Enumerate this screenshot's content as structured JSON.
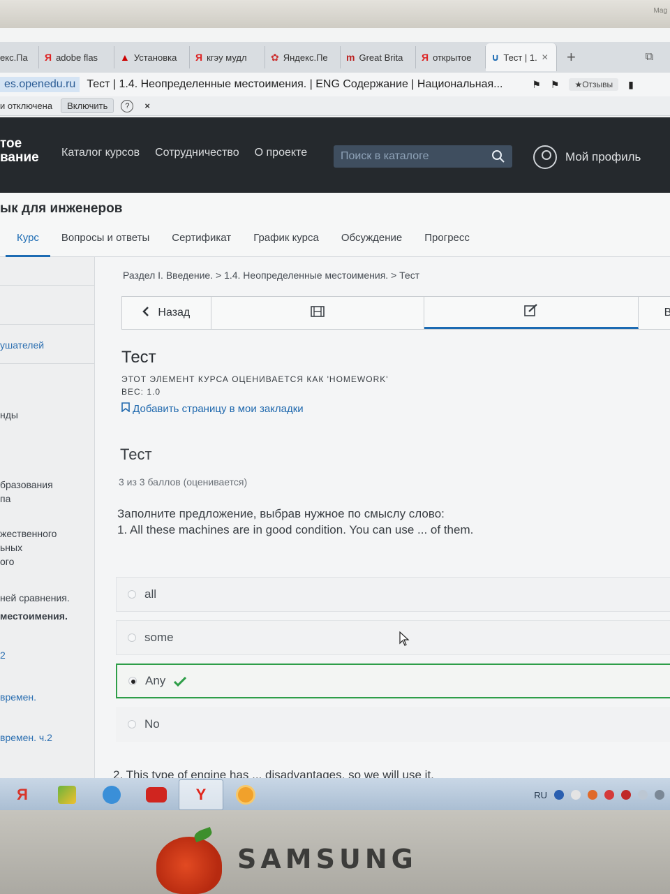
{
  "bezel": {
    "brand_corner": "Mag",
    "brand": "SAMSUNG"
  },
  "browser": {
    "tabs": [
      {
        "icon": "yandex-icon",
        "label": "екс.Па"
      },
      {
        "icon": "yandex-icon",
        "label": "adobe flas"
      },
      {
        "icon": "adobe-icon",
        "label": "Установка"
      },
      {
        "icon": "yandex-icon",
        "label": "кгэу мудл"
      },
      {
        "icon": "puzzle-icon",
        "label": "Яндекс.Пе"
      },
      {
        "icon": "gb-icon",
        "label": "Great Brita"
      },
      {
        "icon": "yandex-icon",
        "label": "открытое"
      },
      {
        "icon": "openedu-icon",
        "label": "Тест | 1."
      }
    ],
    "new_tab": "+",
    "address_host": "es.openedu.ru",
    "address_title": "Тест | 1.4. Неопределенные местоимения. | ENG Содержание | Национальная...",
    "reviews_label": "★Отзывы",
    "infobar_text": "и отключена",
    "infobar_button": "Включить",
    "infobar_help": "?",
    "infobar_close": "×"
  },
  "site": {
    "logo_line1": "тое",
    "logo_line2": "вание",
    "nav": [
      "Каталог курсов",
      "Сотрудничество",
      "О проекте"
    ],
    "search_placeholder": "Поиск в каталоге",
    "profile_label": "Мой профиль"
  },
  "course": {
    "title": "ык для инженеров",
    "tabs": [
      "Курс",
      "Вопросы и ответы",
      "Сертификат",
      "График курса",
      "Обсуждение",
      "Прогресс"
    ]
  },
  "sidebar": {
    "items": [
      {
        "text": "ушателей",
        "style": "link"
      },
      {
        "text": "нды",
        "style": "normal"
      },
      {
        "text": "бразования",
        "style": "normal"
      },
      {
        "text": "па",
        "style": "normal"
      },
      {
        "text": "жественного",
        "style": "normal"
      },
      {
        "text": "ьных",
        "style": "normal"
      },
      {
        "text": "ого",
        "style": "normal"
      },
      {
        "text": "ней сравнения.",
        "style": "normal"
      },
      {
        "text": "местоимения.",
        "style": "bold"
      },
      {
        "text": "2",
        "style": "link"
      },
      {
        "text": "времен.",
        "style": "link"
      },
      {
        "text": "времен. ч.2",
        "style": "link"
      }
    ]
  },
  "unit": {
    "breadcrumb": "Раздел I. Введение. > 1.4. Неопределенные местоимения. > Тест",
    "back_label": "Назад",
    "next_label": "Вп",
    "heading": "Тест",
    "graded_note": "ЭТОТ ЭЛЕМЕНТ КУРСА ОЦЕНИВАЕТСЯ КАК 'HOMEWORK'",
    "weight": "ВЕС: 1.0",
    "bookmark": "Добавить страницу в мои закладки",
    "problem_title": "Тест",
    "score": "3 из 3 баллов (оценивается)",
    "instruction": "Заполните предложение, выбрав нужное по смыслу слово:",
    "q1": "1. All these machines are in good condition. You can use ... of them.",
    "options": [
      {
        "label": "all",
        "selected": false
      },
      {
        "label": "some",
        "selected": false
      },
      {
        "label": "Any",
        "selected": true,
        "correct": true
      },
      {
        "label": "No",
        "selected": false
      }
    ],
    "q2": "2. This type of engine has ... disadvantages, so we will use it."
  },
  "taskbar": {
    "apps": [
      "Я",
      "",
      "",
      "",
      "Y",
      ""
    ],
    "lang": "RU"
  },
  "colors": {
    "accent": "#1c6bb3",
    "correct": "#2e9e48",
    "header_bg": "#25292d"
  }
}
